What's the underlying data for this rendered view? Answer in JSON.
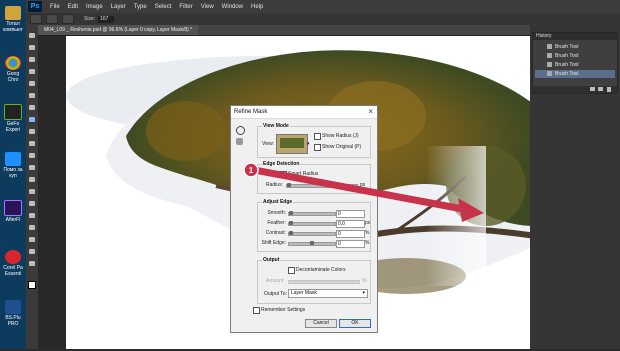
{
  "desktop": {
    "items": [
      {
        "label": "Тотал компьют",
        "color": "#cfa53b"
      },
      {
        "label": "Goog Chro",
        "color": "#e9e9e9"
      },
      {
        "label": "GeFo Experi",
        "color": "#6ab023"
      },
      {
        "label": "Помо за куп",
        "color": "#1e90ff"
      },
      {
        "label": "AfterFl",
        "color": "#6a3fd6"
      },
      {
        "label": "Corel Pa Essenti",
        "color": "#d9262c"
      },
      {
        "label": "BS.Plu PRO",
        "color": "#1f4f8f"
      }
    ]
  },
  "menubar": {
    "logo": "Ps",
    "items": [
      "File",
      "Edit",
      "Image",
      "Layer",
      "Type",
      "Select",
      "Filter",
      "View",
      "Window",
      "Help"
    ]
  },
  "options": {
    "size_label": "Size:",
    "size_value": "167"
  },
  "document": {
    "tab_title": "M04_L09 _ Reshenie.psd @ 96.6% (Layer 0 copy, Layer Mask/8) *"
  },
  "history": {
    "title": "History",
    "items": [
      "Brush Tool",
      "Brush Tool",
      "Brush Tool",
      "Brush Tool"
    ]
  },
  "dialog": {
    "title": "Refine Mask",
    "view_mode": {
      "label": "View Mode",
      "view_label": "View:",
      "show_radius": "Show Radius (J)",
      "show_original": "Show Original (P)"
    },
    "edge_detection": {
      "label": "Edge Detection",
      "smart_radius": "Smart Radius",
      "radius_label": "Radius:",
      "radius_unit": "px"
    },
    "adjust_edge": {
      "label": "Adjust Edge",
      "rows": [
        {
          "label": "Smooth:",
          "value": "0",
          "unit": ""
        },
        {
          "label": "Feather:",
          "value": "0,0",
          "unit": "px"
        },
        {
          "label": "Contrast:",
          "value": "0",
          "unit": "%"
        },
        {
          "label": "Shift Edge:",
          "value": "0",
          "unit": "%"
        }
      ]
    },
    "output": {
      "label": "Output",
      "decontaminate": "Decontaminate Colors",
      "amount_label": "Amount:",
      "amount_unit": "%",
      "output_to_label": "Output To:",
      "output_to_value": "Layer Mask"
    },
    "remember": "Remember Settings",
    "cancel": "Cancel",
    "ok": "OK"
  },
  "annotation": {
    "number": "1",
    "color": "#c8324a"
  }
}
